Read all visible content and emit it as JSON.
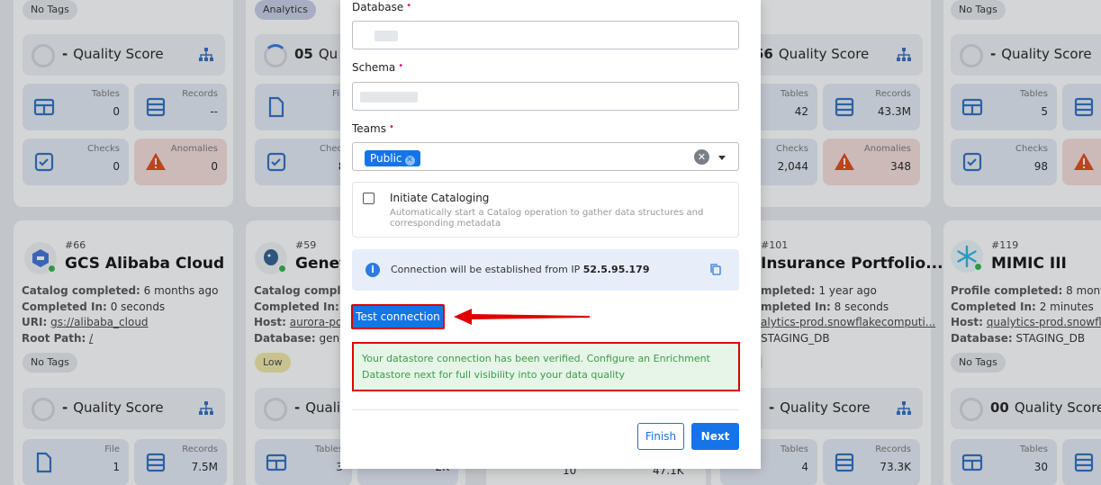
{
  "background": {
    "cards": [
      {
        "id": "card-1",
        "tags_top": "No Tags",
        "quality": {
          "score": "-",
          "label": "Quality Score"
        },
        "stats": [
          {
            "label": "Tables",
            "value": "0"
          },
          {
            "label": "Records",
            "value": "--"
          },
          {
            "label": "Checks",
            "value": "0"
          },
          {
            "label": "Anomalies",
            "value": "0"
          }
        ]
      },
      {
        "id": "card-2",
        "tags_top": "Analytics",
        "quality": {
          "score": "05",
          "label": "Qu"
        },
        "stats": [
          {
            "label": "Files",
            "value": "5"
          },
          {
            "label": "Checks",
            "value": "86"
          }
        ]
      },
      {
        "id": "card-3",
        "quality": {
          "score": "56",
          "label": "Quality Score"
        },
        "stats": [
          {
            "label": "Tables",
            "value": "42"
          },
          {
            "label": "Records",
            "value": "43.3M"
          },
          {
            "label": "Checks",
            "value": "2,044"
          },
          {
            "label": "Anomalies",
            "value": "348"
          }
        ]
      },
      {
        "id": "card-4",
        "tags_top": "No Tags",
        "quality": {
          "score": "-",
          "label": "Quality Score"
        },
        "stats": [
          {
            "label": "Tables",
            "value": "5"
          },
          {
            "label": "Checks",
            "value": "98"
          }
        ]
      }
    ],
    "row2": [
      {
        "number": "#66",
        "title": "GCS Alibaba Cloud",
        "meta": [
          {
            "k": "Catalog completed:",
            "v": "6 months ago"
          },
          {
            "k": "Completed In:",
            "v": "0 seconds"
          },
          {
            "k": "URI:",
            "v": "gs://alibaba_cloud"
          },
          {
            "k": "Root Path:",
            "v": "/"
          }
        ],
        "tag": "No Tags",
        "quality": {
          "score": "-",
          "label": "Quality Score"
        },
        "stats": [
          {
            "label": "File",
            "value": "1"
          },
          {
            "label": "Records",
            "value": "7.5M"
          }
        ]
      },
      {
        "number": "#59",
        "title": "Genet",
        "meta": [
          {
            "k": "Catalog complete",
            "v": ""
          },
          {
            "k": "Completed In:",
            "v": "0 s"
          },
          {
            "k": "Host:",
            "v": "aurora-post"
          },
          {
            "k": "Database:",
            "v": "genete"
          }
        ],
        "tag": "Low",
        "quality": {
          "score": "-",
          "label": "Qualit"
        },
        "stats": [
          {
            "label": "Tables",
            "value": "3"
          },
          {
            "label": "",
            "value": "2K"
          }
        ]
      },
      {
        "number": "#101",
        "title": "Insurance Portfolio...",
        "meta": [
          {
            "k": "mpleted:",
            "v": "1 year ago"
          },
          {
            "k": "mpleted In:",
            "v": "8 seconds"
          },
          {
            "k": "",
            "v": "alytics-prod.snowflakecomputi..."
          },
          {
            "k": "",
            "v": "STAGING_DB"
          }
        ],
        "tag": "s",
        "quality": {
          "score": "-",
          "label": "Quality Score"
        },
        "stats": [
          {
            "label": "Tables",
            "value": "4"
          },
          {
            "label": "Records",
            "value": "73.3K"
          }
        ],
        "partial": [
          "10",
          "47.1K"
        ]
      },
      {
        "number": "#119",
        "title": "MIMIC III",
        "meta": [
          {
            "k": "Profile completed:",
            "v": "8 months ag"
          },
          {
            "k": "Completed In:",
            "v": "2 minutes"
          },
          {
            "k": "Host:",
            "v": "qualytics-prod.snowflake"
          },
          {
            "k": "Database:",
            "v": "STAGING_DB"
          }
        ],
        "tag": "No Tags",
        "quality": {
          "score": "00",
          "label": "Quality Score"
        },
        "stats": [
          {
            "label": "Tables",
            "value": "30"
          }
        ]
      }
    ]
  },
  "modal": {
    "database": {
      "label": "Database",
      "required": "•"
    },
    "schema": {
      "label": "Schema",
      "required": "•"
    },
    "teams": {
      "label": "Teams",
      "required": "•",
      "selected": "Public",
      "chip_remove": "✕",
      "clear": "✕"
    },
    "cataloging": {
      "title": "Initiate Cataloging",
      "description": "Automatically start a Catalog operation to gather data structures and corresponding metadata"
    },
    "info": {
      "icon": "i",
      "text": "Connection will be established from IP ",
      "ip": "52.5.95.179"
    },
    "test_connection": "Test connection",
    "success_message": "Your datastore connection has been verified. Configure an Enrichment Datastore next for full visibility into your data quality",
    "finish": "Finish",
    "next": "Next"
  },
  "colors": {
    "primary": "#1574e8",
    "highlight": "#e00000",
    "success_text": "#3e9a4a",
    "success_bg": "#e6f5e8",
    "required": "#e2137c"
  }
}
